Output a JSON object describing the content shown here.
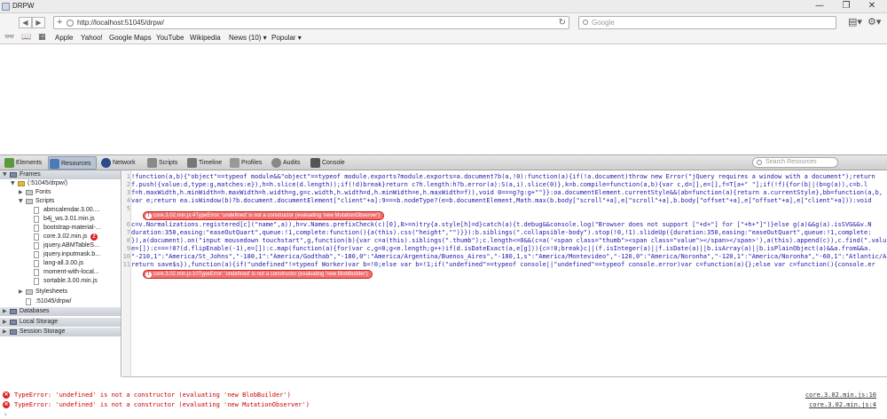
{
  "window": {
    "title": "DRPW",
    "minimize": "—",
    "maximize": "❐",
    "close": "✕"
  },
  "toolbar": {
    "back": "◀",
    "forward": "▶",
    "url": "http://localhost:51045/drpw/",
    "search_placeholder": "Google"
  },
  "bookmarks": [
    "Apple",
    "Yahoo!",
    "Google Maps",
    "YouTube",
    "Wikipedia",
    "News (10) ▾",
    "Popular ▾"
  ],
  "devtools": {
    "tabs": [
      "Elements",
      "Resources",
      "Network",
      "Scripts",
      "Timeline",
      "Profiles",
      "Audits",
      "Console"
    ],
    "selected_tab": "Resources",
    "search_placeholder": "Search Resources"
  },
  "tree": [
    {
      "label": "Frames",
      "level": 0,
      "kind": "section",
      "arrow": "▼"
    },
    {
      "label": "(:51045/drpw/)",
      "level": 1,
      "kind": "folder",
      "arrow": "▼"
    },
    {
      "label": "Fonts",
      "level": 2,
      "kind": "group",
      "arrow": "▶"
    },
    {
      "label": "Scripts",
      "level": 2,
      "kind": "group",
      "arrow": "▼"
    },
    {
      "label": "abmcalendar.3.00....",
      "level": 3,
      "kind": "file"
    },
    {
      "label": "b4j_ws.3.01.min.js",
      "level": 3,
      "kind": "file"
    },
    {
      "label": "bootstrap-material-...",
      "level": 3,
      "kind": "file"
    },
    {
      "label": "core.3.02.min.js",
      "level": 3,
      "kind": "file",
      "badge": "2"
    },
    {
      "label": "jquery.ABMTableS...",
      "level": 3,
      "kind": "file"
    },
    {
      "label": "jquery.inputmask.b...",
      "level": 3,
      "kind": "file"
    },
    {
      "label": "lang-all.3.00.js",
      "level": 3,
      "kind": "file"
    },
    {
      "label": "moment-with-local...",
      "level": 3,
      "kind": "file"
    },
    {
      "label": "sortable.3.00.min.js",
      "level": 3,
      "kind": "file"
    },
    {
      "label": "Stylesheets",
      "level": 2,
      "kind": "group",
      "arrow": "▶"
    },
    {
      "label": ":51045/drpw/",
      "level": 2,
      "kind": "file"
    },
    {
      "label": "Databases",
      "level": 0,
      "kind": "section",
      "arrow": "▶"
    },
    {
      "label": "Local Storage",
      "level": 0,
      "kind": "section",
      "arrow": "▶"
    },
    {
      "label": "Session Storage",
      "level": 0,
      "kind": "section",
      "arrow": "▶"
    }
  ],
  "code_lines": [
    {
      "n": "1",
      "text": "!function(a,b){\"object\"==typeof module&&\"object\"==typeof module.exports?module.exports=a.document?b(a,!0):function(a){if(!a.document)throw new Error(\"jQuery requires a window with a document\");return"
    },
    {
      "n": "2",
      "text": "f.push({value:d,type:g,matches:e}),h=h.slice(d.length));if(!d)break}return c?h.length:h?b.error(a):S(a,i).slice(0)},k=b.compile=function(a,b){var c,d=[],e=[],f=T[a+\" \"];if(!f){for(b||(b=g(a)),c=b.l"
    },
    {
      "n": "3",
      "text": "f=h.maxWidth,h.minWidth=h.maxWidth=h.width=g,g=c.width,h.width=d,h.minWidth=e,h.maxWidth=f)),void 0===g?g:g+\"\"}}:oa.documentElement.currentStyle&&(ab=function(a){return a.currentStyle},bb=function(a,b,"
    },
    {
      "n": "4",
      "text": "var e;return ea.isWindow(b)?b.document.documentElement[\"client\"+a]:9===b.nodeType?(e=b.documentElement,Math.max(b.body[\"scroll\"+a],e[\"scroll\"+a],b.body[\"offset\"+a],e[\"offset\"+a],e[\"client\"+a])):void"
    },
    {
      "n": "5",
      "text": ""
    },
    {
      "n": "6",
      "text": "c=v.Normalizations.registered[c](\"name\",a)),h=v.Names.prefixCheck(c)[0],8>=n)try{a.style[h]=d}catch(a){t.debug&&console.log(\"Browser does not support [\"+d+\"] for [\"+h+\"]\")}else g(a)&&g(a).isSVG&&v.N"
    },
    {
      "n": "7",
      "text": "duration:350,easing:\"easeOutQuart\",queue:!1,complete:function(){a(this).css(\"height\",\"\")}}):b.siblings(\".collapsible-body\").stop(!0,!1).slideUp({duration:350,easing:\"easeOutQuart\",queue:!1,complete:"
    },
    {
      "n": "8",
      "text": "}),a(document).on(\"input mousedown touchstart\",g,function(b){var c=a(this).siblings(\".thumb\");c.length<=0&&(c=a('<span class=\"thumb\"><span class=\"value\"></span></span>'),a(this).append(c)),c.find(\".valu"
    },
    {
      "n": "9",
      "text": "e=[]):c===!0?(d.flipEnable(-1),e=[]):c.map(function(a){for(var c,g=0;g<e.length;g++)if(d.isDateExact(a,e[g])){c=!0;break}c||(f.isInteger(a)||f.isDate(a)||b.isArray(a)||b.isPlainObject(a)&&a.from&&a."
    },
    {
      "n": "10",
      "text": "\"-210,1\":\"America/St_Johns\",\"-180,1\":\"America/Godthab\",\"-180,0\":\"America/Argentina/Buenos_Aires\",\"-180,1,s\":\"America/Montevideo\",\"-120,0\":\"America/Noronha\",\"-120,1\":\"America/Noronha\",\"-60,1\":\"Atlantic/Az"
    },
    {
      "n": "11",
      "text": "return save$s}),function(a){if(\"undefined\"!=typeof Worker)var b=!0;else var b=!1;if(\"undefined\"==typeof console||\"undefined\"==typeof console.error)var c=function(a){};else var c=function(){console.er"
    }
  ],
  "inline_errors": [
    {
      "text": "core.3.02.min.js:4TypeError: 'undefined' is not a constructor (evaluating 'new MutationObserver')"
    },
    {
      "text": "core.3.02.min.js:10TypeError: 'undefined' is not a constructor (evaluating 'new BlobBuilder')"
    }
  ],
  "console": [
    {
      "message": "TypeError: 'undefined' is not a constructor (evaluating 'new BlobBuilder')",
      "source": "core.3.02.min.js:10"
    },
    {
      "message": "TypeError: 'undefined' is not a constructor (evaluating 'new MutationObserver')",
      "source": "core.3.02.min.js:4"
    }
  ],
  "prompt": "›",
  "colors": {
    "error": "#e02020",
    "selected_tab": "#b8c4d4",
    "code": "#1a1aa6"
  }
}
